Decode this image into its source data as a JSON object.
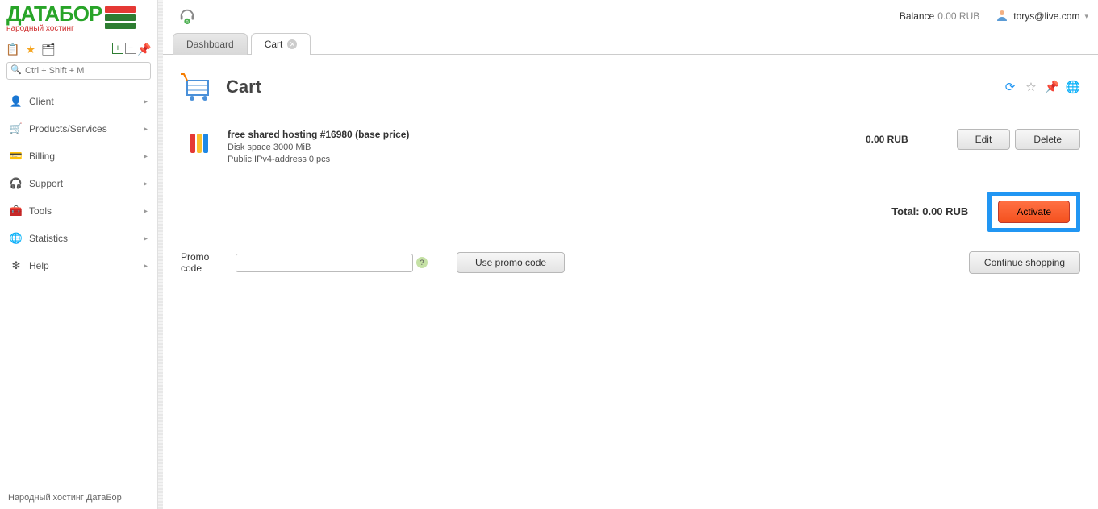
{
  "logo": {
    "name": "ДАТАБОР",
    "tagline": "народный хостинг"
  },
  "sidebar": {
    "search_placeholder": "Ctrl + Shift + M",
    "items": [
      {
        "label": "Client",
        "icon": "👤"
      },
      {
        "label": "Products/Services",
        "icon": "🛒"
      },
      {
        "label": "Billing",
        "icon": "💳"
      },
      {
        "label": "Support",
        "icon": "🎧"
      },
      {
        "label": "Tools",
        "icon": "🧰"
      },
      {
        "label": "Statistics",
        "icon": "🌐"
      },
      {
        "label": "Help",
        "icon": "❇"
      }
    ],
    "footer": "Народный хостинг ДатаБор"
  },
  "header": {
    "balance_label": "Balance",
    "balance_value": "0.00 RUB",
    "user_email": "torys@live.com"
  },
  "tabs": [
    {
      "label": "Dashboard",
      "active": false
    },
    {
      "label": "Cart",
      "active": true
    }
  ],
  "page": {
    "title": "Cart"
  },
  "cart": {
    "items": [
      {
        "name": "free shared hosting #16980 (base price)",
        "line1": "Disk space 3000 MiB",
        "line2": "Public IPv4-address 0 pcs",
        "price": "0.00 RUB"
      }
    ],
    "buttons": {
      "edit": "Edit",
      "delete": "Delete"
    },
    "total_label": "Total: 0.00 RUB",
    "activate": "Activate",
    "continue": "Continue shopping"
  },
  "promo": {
    "label": "Promo code",
    "button": "Use promo code"
  }
}
